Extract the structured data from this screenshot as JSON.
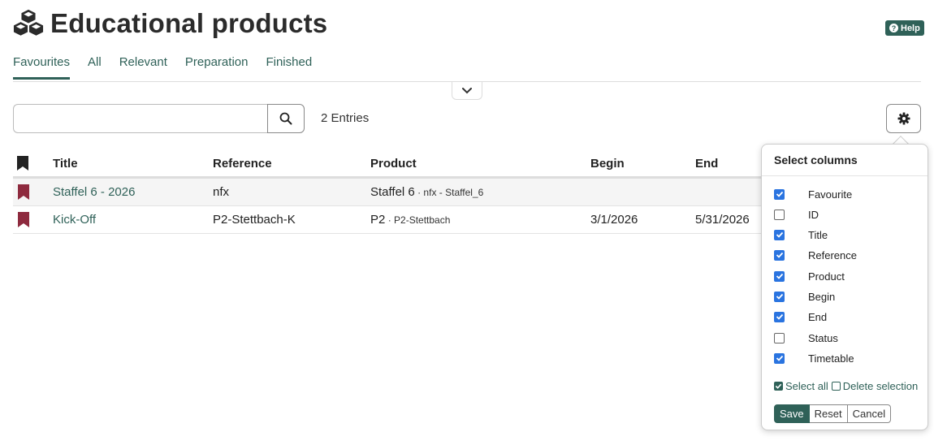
{
  "header": {
    "title": "Educational products",
    "help_label": "Help",
    "icon": "cubes-icon"
  },
  "tabs": [
    {
      "label": "Favourites",
      "active": true
    },
    {
      "label": "All",
      "active": false
    },
    {
      "label": "Relevant",
      "active": false
    },
    {
      "label": "Preparation",
      "active": false
    },
    {
      "label": "Finished",
      "active": false
    }
  ],
  "search": {
    "value": "",
    "placeholder": ""
  },
  "entries_label": "2 Entries",
  "table": {
    "columns": [
      "Title",
      "Reference",
      "Product",
      "Begin",
      "End"
    ],
    "rows": [
      {
        "title": "Staffel 6 - 2026",
        "reference": "nfx",
        "product_main": "Staffel 6",
        "product_sub": " · nfx - Staffel_6",
        "begin": "",
        "end": ""
      },
      {
        "title": "Kick-Off",
        "reference": "P2-Stettbach-K",
        "product_main": "P2",
        "product_sub": " · P2-Stettbach",
        "begin": "3/1/2026",
        "end": "5/31/2026"
      }
    ]
  },
  "column_panel": {
    "title": "Select columns",
    "items": [
      {
        "label": "Favourite",
        "checked": true
      },
      {
        "label": "ID",
        "checked": false
      },
      {
        "label": "Title",
        "checked": true
      },
      {
        "label": "Reference",
        "checked": true
      },
      {
        "label": "Product",
        "checked": true
      },
      {
        "label": "Begin",
        "checked": true
      },
      {
        "label": "End",
        "checked": true
      },
      {
        "label": "Status",
        "checked": false
      },
      {
        "label": "Timetable",
        "checked": true
      }
    ],
    "select_all_label": "Select all",
    "delete_selection_label": "Delete selection",
    "save_label": "Save",
    "reset_label": "Reset",
    "cancel_label": "Cancel"
  },
  "colors": {
    "accent": "#2f6158",
    "bookmark": "#8e2a3e",
    "checkbox": "#2a74e0"
  }
}
